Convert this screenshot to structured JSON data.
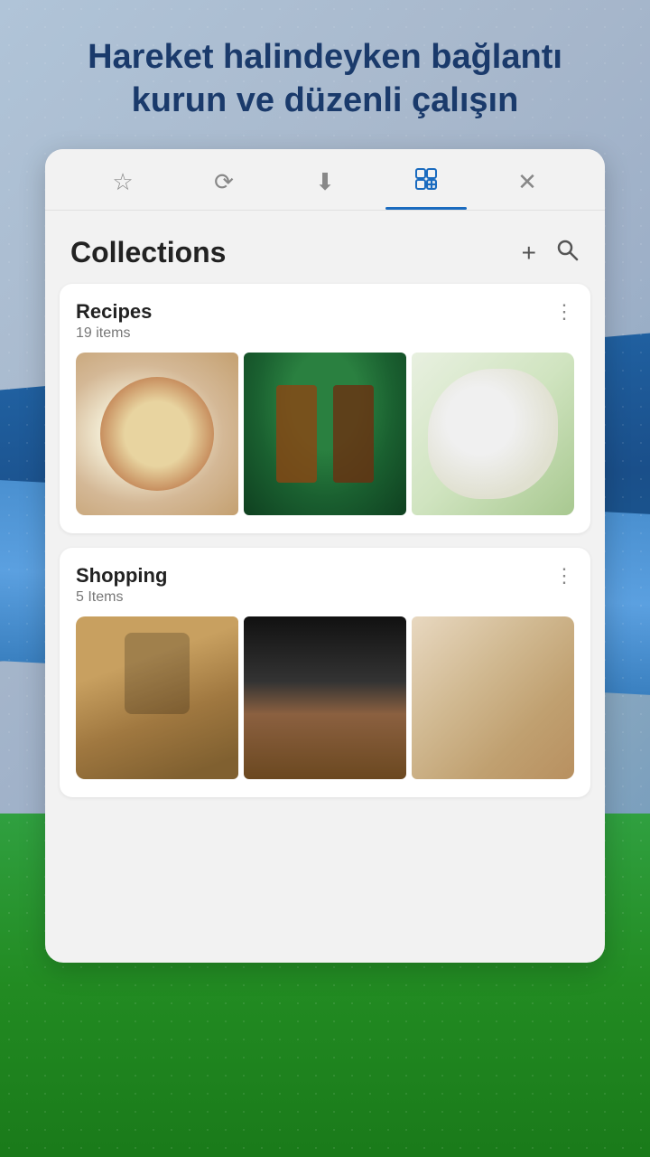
{
  "hero": {
    "title": "Hareket halindeyken bağlantı kurun ve düzenli çalışın"
  },
  "tabs": [
    {
      "id": "bookmarks",
      "icon": "☆",
      "label": "Bookmarks",
      "active": false
    },
    {
      "id": "history",
      "icon": "↺",
      "label": "History",
      "active": false
    },
    {
      "id": "downloads",
      "icon": "↓",
      "label": "Downloads",
      "active": false
    },
    {
      "id": "collections",
      "icon": "⊞",
      "label": "Collections",
      "active": true
    },
    {
      "id": "close",
      "icon": "✕",
      "label": "Close",
      "active": false
    }
  ],
  "collections": {
    "title": "Collections",
    "add_icon": "+",
    "search_icon": "🔍",
    "items": [
      {
        "id": "recipes",
        "name": "Recipes",
        "count": "19 items",
        "more_icon": "⋮"
      },
      {
        "id": "shopping",
        "name": "Shopping",
        "count": "5 Items",
        "more_icon": "⋮"
      }
    ]
  }
}
